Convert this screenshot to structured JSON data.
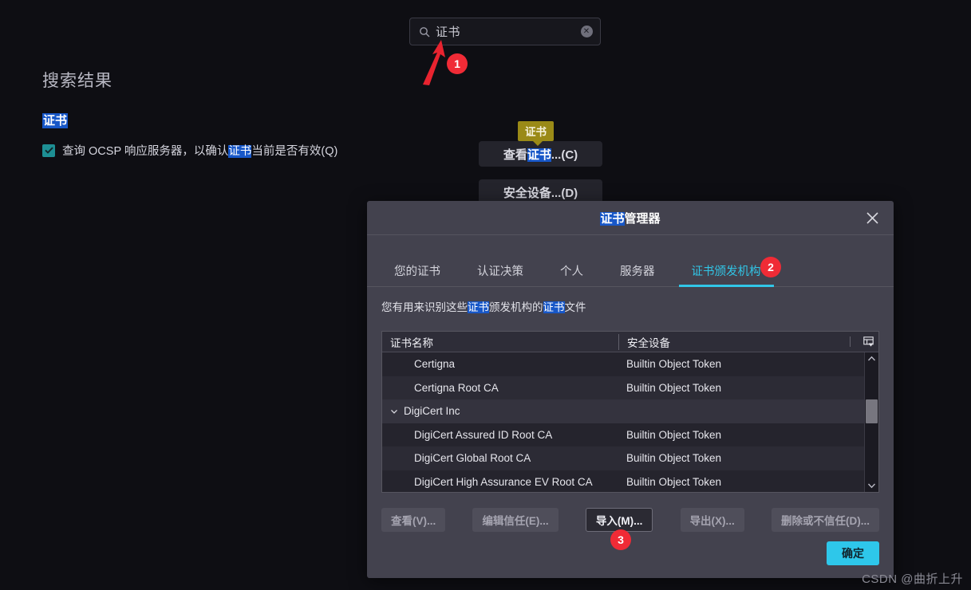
{
  "search": {
    "value": "证书",
    "icon": "search-icon",
    "clear_icon": "clear-icon"
  },
  "results": {
    "heading": "搜索结果",
    "group_label": "证书",
    "preference": {
      "text_before": "查询 OCSP 响应服务器，以确认",
      "highlight": "证书",
      "text_after": "当前是否有效(Q)",
      "checked": true
    }
  },
  "pref_buttons": {
    "view_cert_before": "查看",
    "view_cert_highlight": "证书",
    "view_cert_after": "...(C)",
    "security_devices": "安全设备...(D)"
  },
  "tooltip": {
    "text": "证书"
  },
  "dialog": {
    "title_highlight": "证书",
    "title_rest": "管理器",
    "close_icon": "close-icon",
    "tabs": [
      {
        "label": "您的证书",
        "active": false
      },
      {
        "label": "认证决策",
        "active": false
      },
      {
        "label": "个人",
        "active": false
      },
      {
        "label": "服务器",
        "active": false
      },
      {
        "label": "证书颁发机构",
        "active": true
      }
    ],
    "description": {
      "part1": "您有用来识别这些",
      "hl1": "证书",
      "part2": "颁发机构的",
      "hl2": "证书",
      "part3": "文件"
    },
    "table": {
      "columns": [
        "证书名称",
        "安全设备"
      ],
      "column_picker_icon": "column-options-icon",
      "rows": [
        {
          "type": "cert",
          "name": "Certigna",
          "device": "Builtin Object Token"
        },
        {
          "type": "cert",
          "name": "Certigna Root CA",
          "device": "Builtin Object Token"
        },
        {
          "type": "group",
          "name": "DigiCert Inc",
          "device": ""
        },
        {
          "type": "cert",
          "name": "DigiCert Assured ID Root CA",
          "device": "Builtin Object Token"
        },
        {
          "type": "cert",
          "name": "DigiCert Global Root CA",
          "device": "Builtin Object Token"
        },
        {
          "type": "cert",
          "name": "DigiCert High Assurance EV Root CA",
          "device": "Builtin Object Token"
        }
      ],
      "scroll_up_icon": "chevron-up-icon",
      "scroll_down_icon": "chevron-down-icon"
    },
    "actions": [
      {
        "label": "查看(V)...",
        "focused": false
      },
      {
        "label": "编辑信任(E)...",
        "focused": false
      },
      {
        "label": "导入(M)...",
        "focused": true
      },
      {
        "label": "导出(X)...",
        "focused": false
      },
      {
        "label": "删除或不信任(D)...",
        "focused": false
      }
    ],
    "ok_label": "确定"
  },
  "annotations": {
    "badge1": "1",
    "badge2": "2",
    "badge3": "3",
    "arrow_color": "#e8232f",
    "badge_color": "#f02b36"
  },
  "watermark": "CSDN @曲折上升"
}
